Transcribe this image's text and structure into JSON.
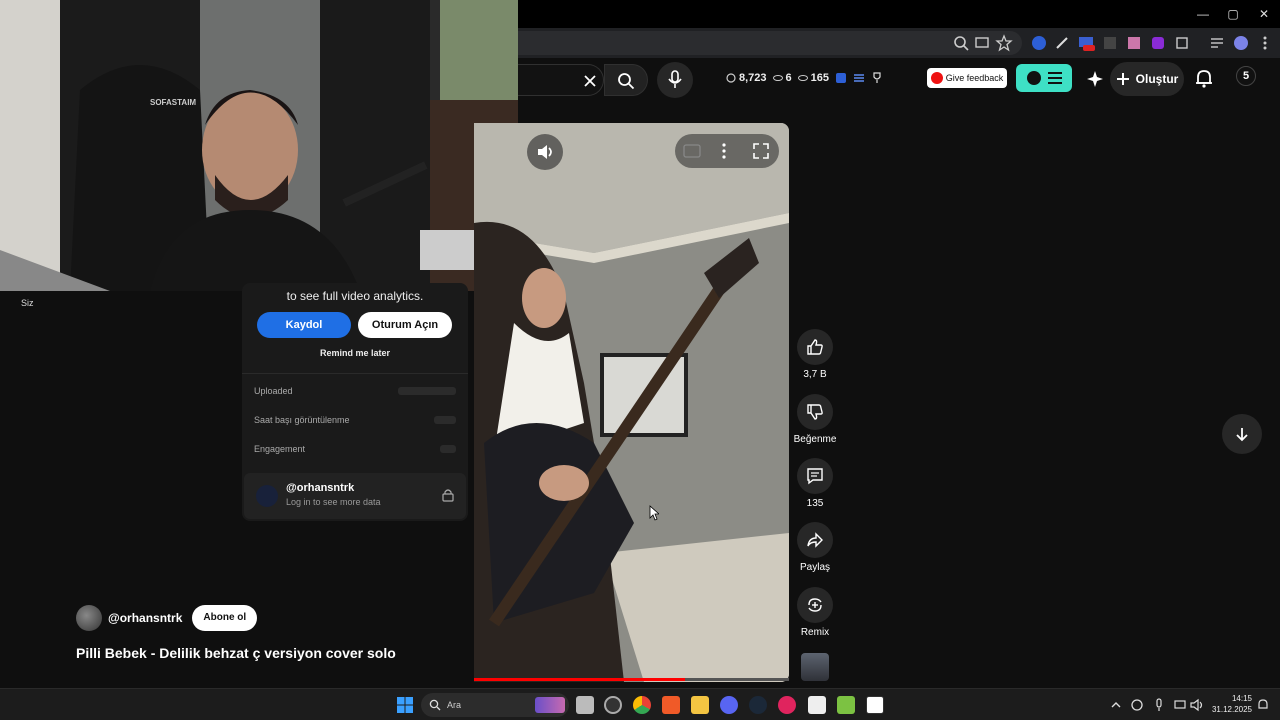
{
  "window": {
    "minimize": "—",
    "maximize": "▢",
    "close": "✕"
  },
  "header": {
    "stats": {
      "timer": "8,723",
      "views_small": "6",
      "views": "165"
    },
    "give_feedback": "Give feedback",
    "create_label": "Oluştur",
    "avatar_letter": "5"
  },
  "webcam": {
    "chair_text": "SOFASTAIM"
  },
  "sidebar": {
    "you_label": "Siz"
  },
  "analytics": {
    "prompt": "to see full video analytics.",
    "signup_label": "Kaydol",
    "login_label": "Oturum Açın",
    "remind_label": "Remind me later",
    "rows": [
      "Uploaded",
      "Saat başı görüntülenme",
      "Engagement"
    ],
    "user_handle": "@orhansntrk",
    "user_sub": "Log in to see more data"
  },
  "channel": {
    "handle": "@orhansntrk",
    "subscribe_label": "Abone ol"
  },
  "video": {
    "title": "Pilli Bebek - Delilik behzat ç versiyon cover solo",
    "progress": 0.67
  },
  "actions": {
    "like_count": "3,7 B",
    "dislike_label": "Beğenme",
    "comment_count": "135",
    "share_label": "Paylaş",
    "remix_label": "Remix"
  },
  "taskbar": {
    "search_placeholder": "Ara",
    "time": "14:15",
    "date": "31.12.2025"
  },
  "colors": {
    "accent_blue": "#1f6fe5",
    "teal": "#3ee0c5",
    "progress_red": "#ff0000"
  }
}
